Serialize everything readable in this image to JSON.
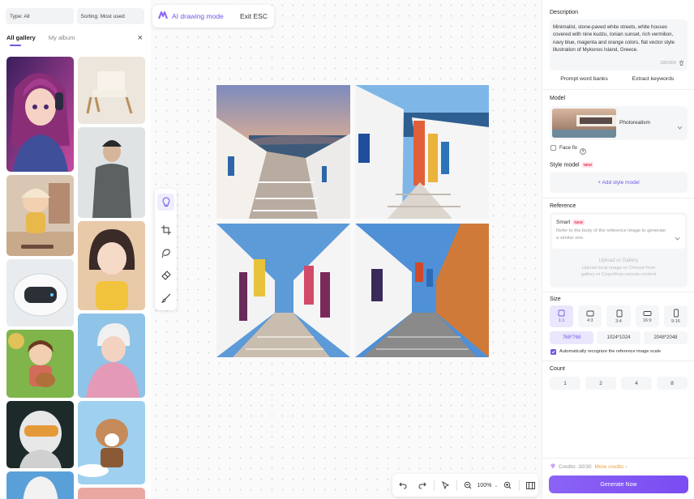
{
  "gallery": {
    "type_filter": "Type: All",
    "sort_filter": "Sorting: Most used",
    "tabs": [
      "All gallery",
      "My album"
    ],
    "close_glyph": "×"
  },
  "mode_bar": {
    "mode_label": "AI drawing mode",
    "exit_label": "Exit ESC"
  },
  "toolbar": {
    "tools": [
      "idea-bulb-icon",
      "crop-icon",
      "lasso-icon",
      "eraser-icon",
      "brush-icon"
    ]
  },
  "zoom": {
    "level": "100%",
    "chevron": "⌄"
  },
  "panel": {
    "description_label": "Description",
    "description_text": "Minimalist, stone-paved white streets, white houses covered with nine kudzu, Ionian sunset, rich vermilion, navy blue, magenta and orange colors, flat vector style illustration of Mykonos Island, Greece.",
    "description_count": "180/300",
    "prompt_word_banks": "Prompt word banks",
    "extract_keywords": "Extract keywords",
    "model_label": "Model",
    "model_name": "Photorealism",
    "face_fix": "Face fix",
    "style_model_label": "Style model",
    "new_badge": "NEW",
    "add_style_model": "+ Add style model",
    "reference_label": "Reference",
    "smart_label": "Smart",
    "smart_desc": "Refer to the body of the reference image to generate a similar one.",
    "upload_line1": "Upload or Gallery",
    "upload_line2": "Upload local image or Choose from",
    "upload_line3": "gallery or Copy/drop canvas content",
    "size_label": "Size",
    "sizes": [
      "1:1",
      "4:3",
      "3:4",
      "16:9",
      "9:16"
    ],
    "resolutions": [
      "768*768",
      "1024*1024",
      "2048*2048"
    ],
    "auto_recognize": "Automatically recognize the reference image scale",
    "count_label": "Count",
    "counts": [
      "1",
      "2",
      "4",
      "8"
    ],
    "credits": "Credits: 30/30",
    "more_credits": "More credits ›",
    "generate": "Generate Now"
  },
  "colors": {
    "accent": "#6f56e8",
    "panel_bg": "#f5f6f8",
    "credits_link": "#e6a23c"
  }
}
